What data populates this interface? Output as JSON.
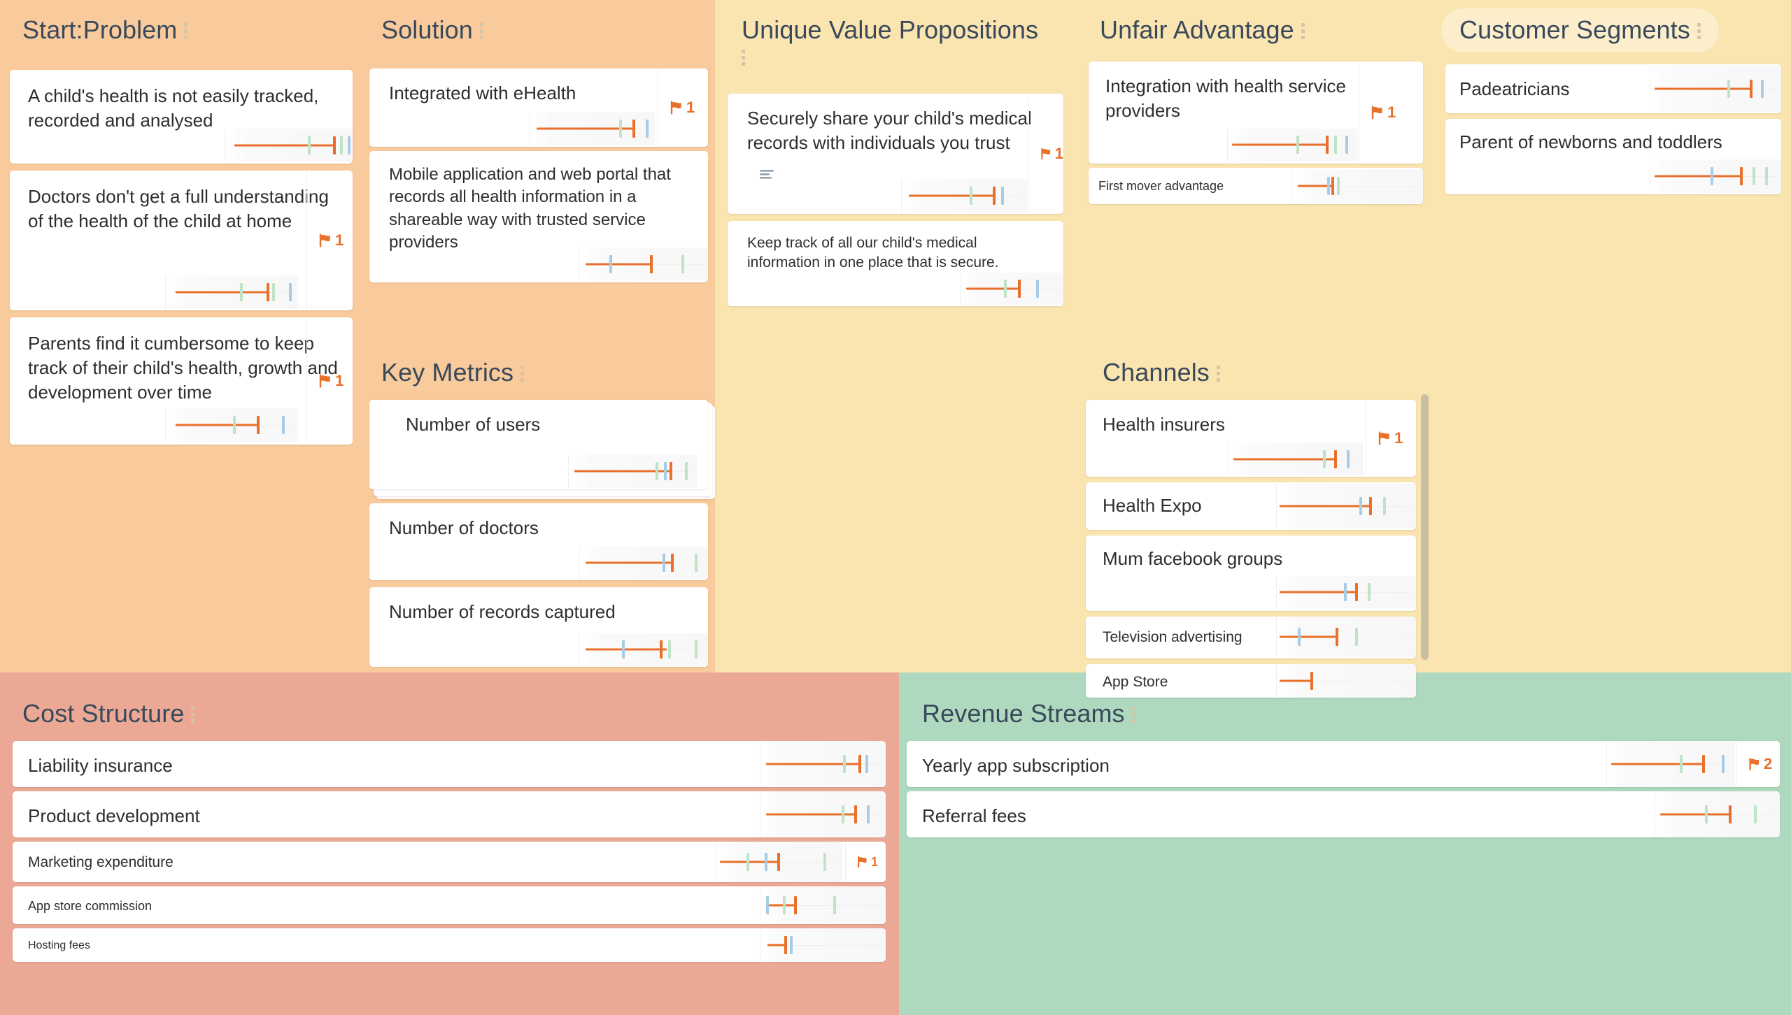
{
  "colors": {
    "panel_peach": "#F9CB9C",
    "panel_yellow": "#FAE4AF",
    "panel_pink": "#EBA995",
    "panel_green": "#AED9BE",
    "accent_orange": "#E8702A",
    "tick_green": "#BFE3C6",
    "tick_blue": "#A7CCE8",
    "header_text": "#39495B",
    "card_text": "#2E2E2E",
    "selected_header_bg": "#FCEDCB",
    "scrollbar": "#C9BFA3"
  },
  "sections": {
    "problem": {
      "title": "Start:Problem",
      "menu_icon": "kebab-menu-icon"
    },
    "solution": {
      "title": "Solution",
      "menu_icon": "kebab-menu-icon"
    },
    "key_metrics": {
      "title": "Key Metrics",
      "menu_icon": "kebab-menu-icon"
    },
    "uvp": {
      "title": "Unique Value Propositions",
      "menu_icon": "kebab-menu-icon"
    },
    "unfair": {
      "title": "Unfair Advantage",
      "menu_icon": "kebab-menu-icon"
    },
    "channels": {
      "title": "Channels",
      "menu_icon": "kebab-menu-icon"
    },
    "customer": {
      "title": "Customer Segments",
      "menu_icon": "kebab-menu-icon",
      "selected": true
    },
    "cost": {
      "title": "Cost Structure",
      "menu_icon": "kebab-menu-icon"
    },
    "revenue": {
      "title": "Revenue Streams",
      "menu_icon": "kebab-menu-icon"
    }
  },
  "cards": {
    "problem": [
      {
        "text": "A child's health is not easily tracked, recorded and analysed",
        "flag": null
      },
      {
        "text": "Doctors don't get a full understanding of the health of the child at home",
        "flag": "1"
      },
      {
        "text": "Parents find it cumbersome to keep track of their child's health, growth and development over time",
        "flag": "1"
      }
    ],
    "solution": [
      {
        "text": "Integrated with eHealth",
        "flag": "1"
      },
      {
        "text": "Mobile application and web portal that records all health information in a shareable way with trusted service providers",
        "flag": null
      }
    ],
    "key_metrics": [
      {
        "text": "Number of users",
        "flag": null,
        "stacked": true
      },
      {
        "text": "Number of doctors",
        "flag": null
      },
      {
        "text": "Number of records captured",
        "flag": null
      }
    ],
    "uvp": [
      {
        "text": "Securely share your child's medical records with individuals you trust",
        "flag": "1",
        "notes_icon": "notes-lines-icon"
      },
      {
        "text": "Keep track of all our child's medical information in one place that is secure.",
        "flag": null
      }
    ],
    "unfair": [
      {
        "text": "Integration with health service providers",
        "flag": "1"
      },
      {
        "text": "First mover advantage",
        "flag": null
      }
    ],
    "channels": [
      {
        "text": "Health insurers",
        "flag": "1"
      },
      {
        "text": "Health Expo",
        "flag": null
      },
      {
        "text": "Mum facebook groups",
        "flag": null
      },
      {
        "text": "Television advertising",
        "flag": null
      },
      {
        "text": "App Store",
        "flag": null,
        "clipped": true
      }
    ],
    "customer": [
      {
        "text": "Padeatricians",
        "flag": null
      },
      {
        "text": "Parent of newborns and toddlers",
        "flag": null
      }
    ],
    "cost": [
      {
        "text": "Liability insurance",
        "flag": null
      },
      {
        "text": "Product development",
        "flag": null
      },
      {
        "text": "Marketing expenditure",
        "flag": "1"
      },
      {
        "text": "App store commission",
        "flag": null
      },
      {
        "text": "Hosting fees",
        "flag": null
      }
    ],
    "revenue": [
      {
        "text": "Yearly app subscription",
        "flag": "2"
      },
      {
        "text": "Referral fees",
        "flag": null
      }
    ]
  }
}
